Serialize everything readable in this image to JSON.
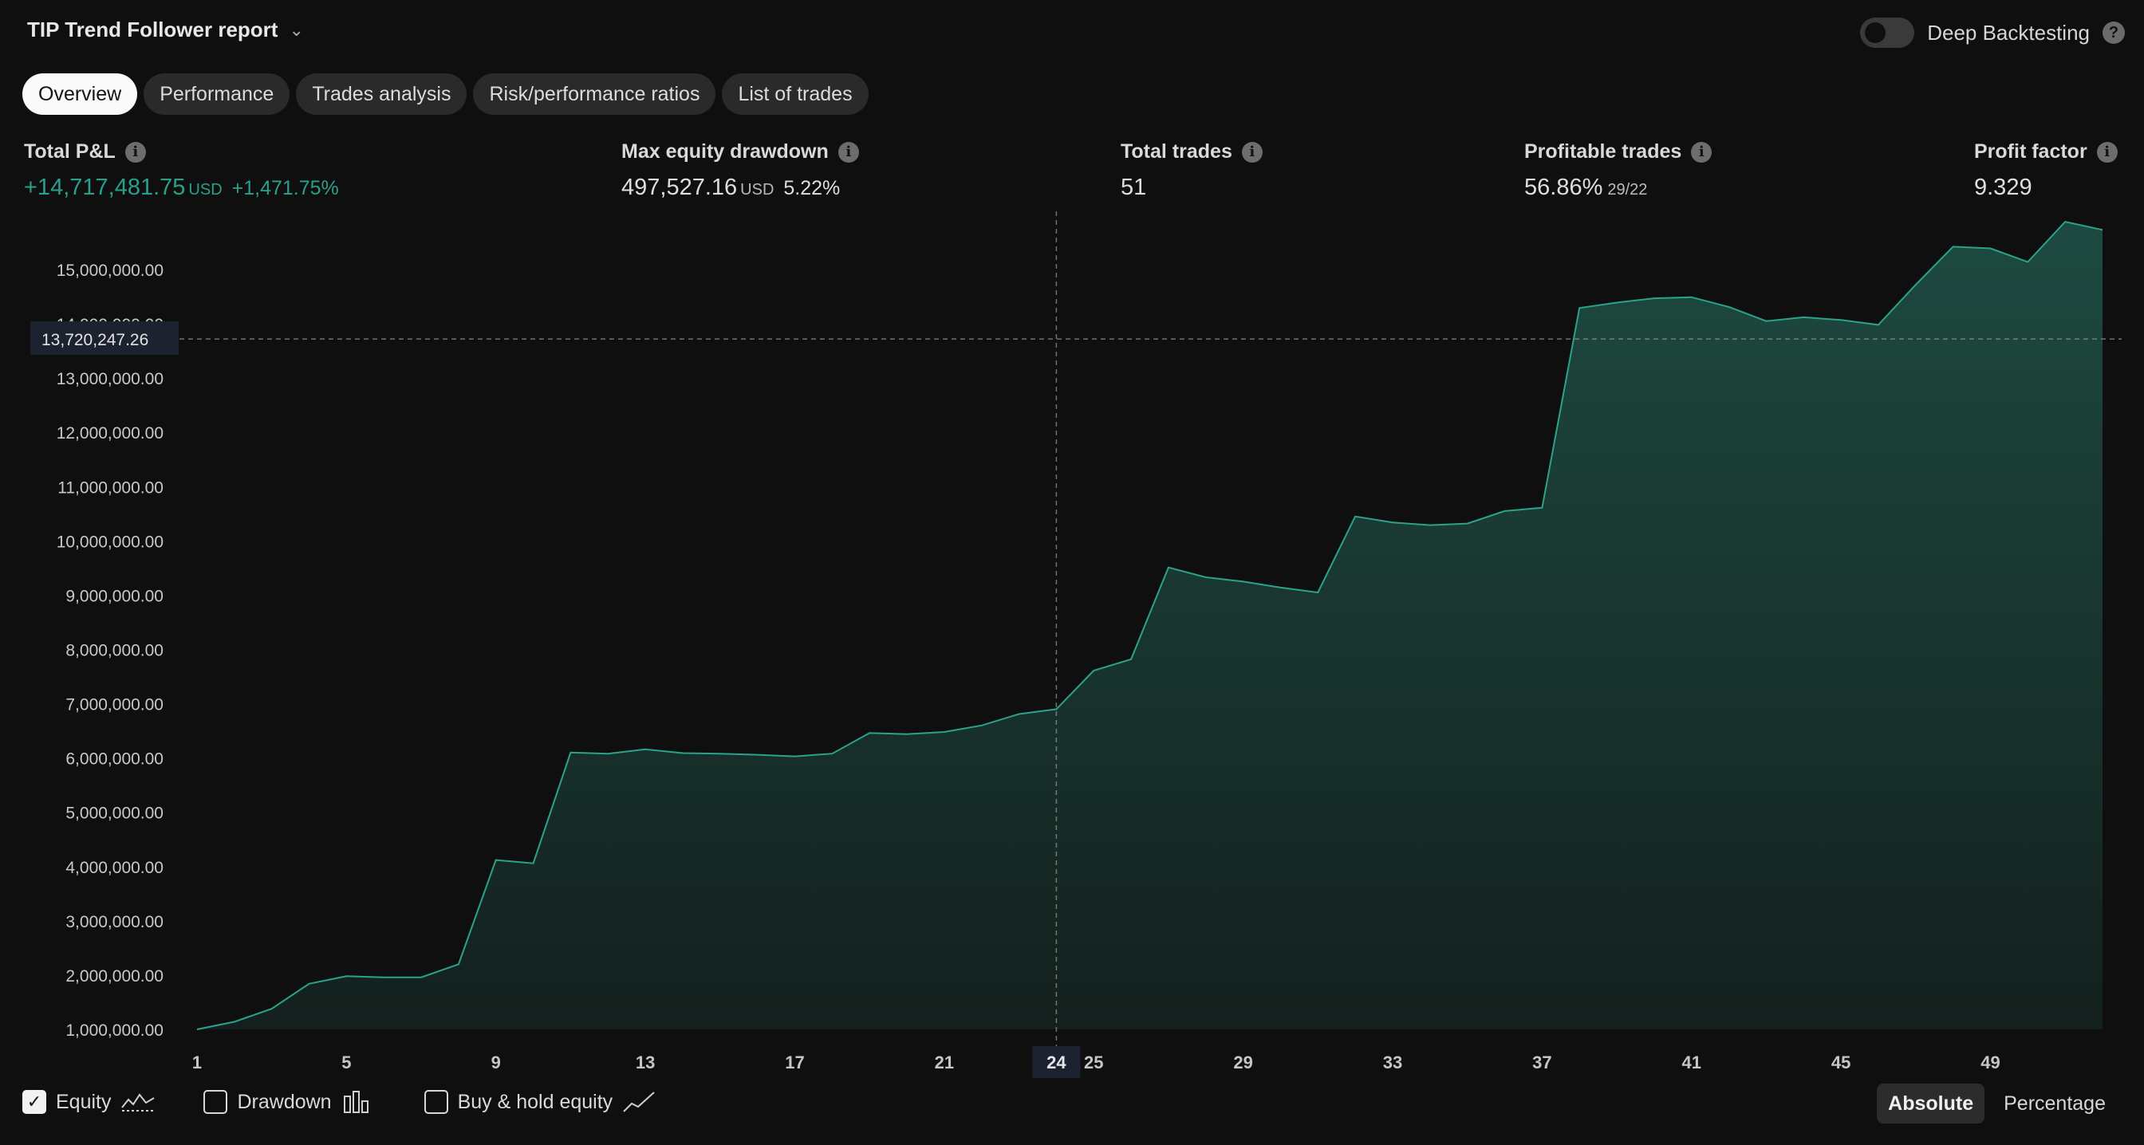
{
  "header": {
    "title": "TIP Trend Follower report",
    "deep_label": "Deep Backtesting",
    "help": "?"
  },
  "tabs": [
    {
      "label": "Overview",
      "active": true
    },
    {
      "label": "Performance"
    },
    {
      "label": "Trades analysis"
    },
    {
      "label": "Risk/performance ratios"
    },
    {
      "label": "List of trades"
    }
  ],
  "stats": {
    "pnl": {
      "label": "Total P&L",
      "value": "+14,717,481.75",
      "unit": "USD",
      "extra": "+1,471.75%"
    },
    "drawdown": {
      "label": "Max equity drawdown",
      "value": "497,527.16",
      "unit": "USD",
      "extra": "5.22%"
    },
    "trades": {
      "label": "Total trades",
      "value": "51"
    },
    "profitable": {
      "label": "Profitable trades",
      "value": "56.86%",
      "extra": "29/22"
    },
    "pf": {
      "label": "Profit factor",
      "value": "9.329"
    },
    "info_glyph": "i"
  },
  "chart_data": {
    "type": "area",
    "series": [
      {
        "name": "Equity",
        "color": "#2aa38b",
        "x": [
          1,
          2,
          3,
          4,
          5,
          6,
          7,
          8,
          9,
          10,
          11,
          12,
          13,
          14,
          15,
          16,
          17,
          18,
          19,
          20,
          21,
          22,
          23,
          24,
          25,
          26,
          27,
          28,
          29,
          30,
          31,
          32,
          33,
          34,
          35,
          36,
          37,
          38,
          39,
          40,
          41,
          42,
          43,
          44,
          45,
          46,
          47,
          48,
          49,
          50,
          51,
          52
        ],
        "values": [
          1000000,
          1140000,
          1380000,
          1840000,
          1980000,
          1960000,
          1960000,
          2200000,
          4120000,
          4060000,
          6100000,
          6080000,
          6160000,
          6090000,
          6080000,
          6060000,
          6030000,
          6080000,
          6460000,
          6440000,
          6480000,
          6600000,
          6810000,
          6900000,
          7610000,
          7820000,
          9510000,
          9330000,
          9250000,
          9140000,
          9050000,
          10450000,
          10340000,
          10290000,
          10320000,
          10550000,
          10610000,
          14290000,
          14390000,
          14470000,
          14490000,
          14310000,
          14050000,
          14120000,
          14070000,
          13980000,
          14720000,
          15420000,
          15390000,
          15140000,
          15880000,
          15730000
        ]
      }
    ],
    "x_ticks": [
      "1",
      "5",
      "9",
      "13",
      "17",
      "21",
      "24",
      "25",
      "29",
      "33",
      "37",
      "41",
      "45",
      "49"
    ],
    "y_ticks": [
      "1,000,000.00",
      "2,000,000.00",
      "3,000,000.00",
      "4,000,000.00",
      "5,000,000.00",
      "6,000,000.00",
      "7,000,000.00",
      "8,000,000.00",
      "9,000,000.00",
      "10,000,000.00",
      "11,000,000.00",
      "12,000,000.00",
      "13,000,000.00",
      "14,000,000.00",
      "15,000,000.00"
    ],
    "ylim": [
      1000000,
      15000000
    ],
    "crosshair": {
      "x": 24,
      "y": 13720247.26,
      "y_label": "13,720,247.26",
      "x_label": "24"
    },
    "grid": false
  },
  "legend": [
    {
      "label": "Equity",
      "checked": true,
      "icon": "area-line-icon"
    },
    {
      "label": "Drawdown",
      "checked": false,
      "icon": "bar-chart-icon"
    },
    {
      "label": "Buy & hold equity",
      "checked": false,
      "icon": "line-chart-icon"
    }
  ],
  "mode": {
    "absolute": "Absolute",
    "percentage": "Percentage"
  },
  "checkmark": "✓"
}
